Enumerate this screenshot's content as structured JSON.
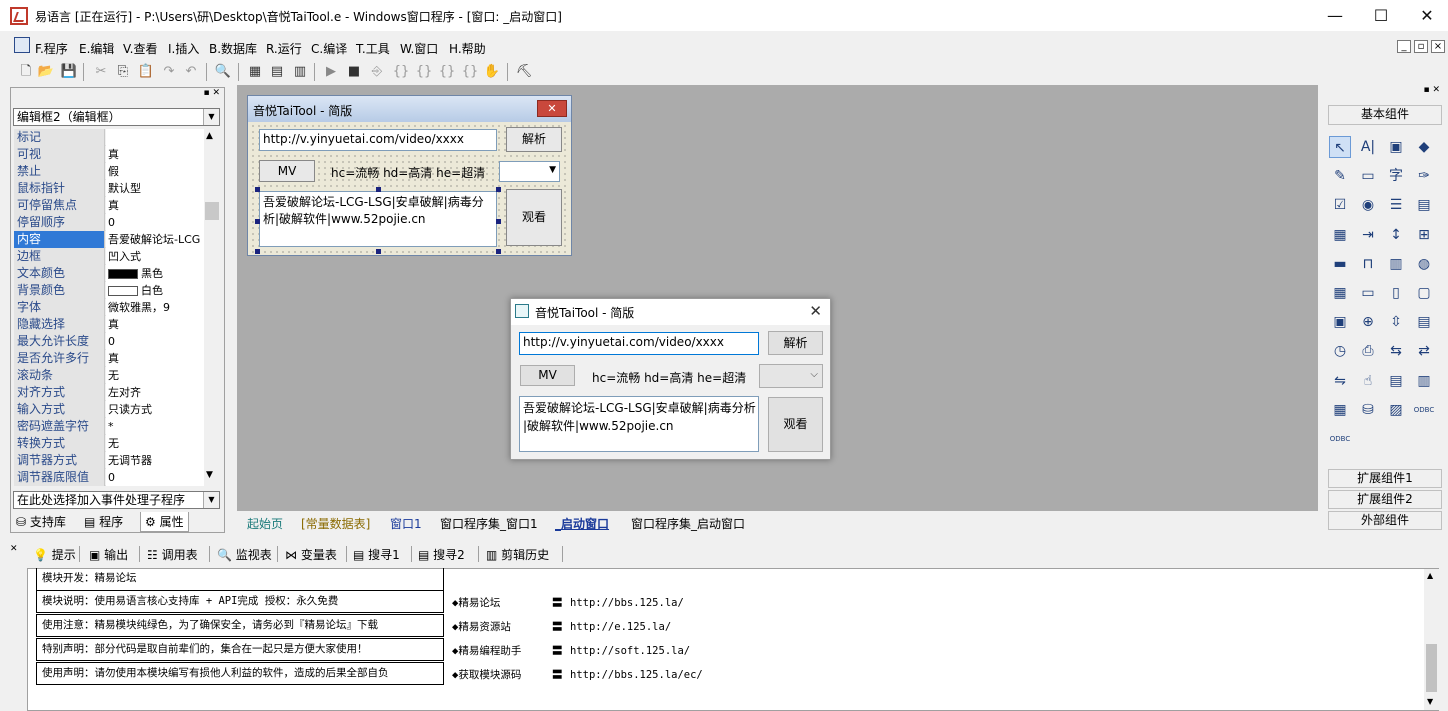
{
  "window": {
    "title": "易语言 [正在运行] - P:\\Users\\研\\Desktop\\音悦TaiTool.e - Windows窗口程序 - [窗口: _启动窗口]",
    "minimize": "—",
    "maximize": "☐",
    "close": "✕"
  },
  "menu": [
    "F.程序",
    "E.编辑",
    "V.查看",
    "I.插入",
    "B.数据库",
    "R.运行",
    "C.编译",
    "T.工具",
    "W.窗口",
    "H.帮助"
  ],
  "left_panel": {
    "component_select": "编辑框2（编辑框）",
    "properties": [
      {
        "name": "标记",
        "value": ""
      },
      {
        "name": "可视",
        "value": "真"
      },
      {
        "name": "禁止",
        "value": "假"
      },
      {
        "name": "鼠标指针",
        "value": "默认型"
      },
      {
        "name": "可停留焦点",
        "value": "真"
      },
      {
        "name": "  停留顺序",
        "value": "0"
      },
      {
        "name": "内容",
        "value": "吾爱破解论坛-LCG"
      },
      {
        "name": "边框",
        "value": "凹入式"
      },
      {
        "name": "文本颜色",
        "value": "黑色"
      },
      {
        "name": "背景颜色",
        "value": "白色"
      },
      {
        "name": "字体",
        "value": "微软雅黑，9"
      },
      {
        "name": "隐藏选择",
        "value": "真"
      },
      {
        "name": "最大允许长度",
        "value": "0"
      },
      {
        "name": "是否允许多行",
        "value": "真"
      },
      {
        "name": "滚动条",
        "value": "无"
      },
      {
        "name": "对齐方式",
        "value": "左对齐"
      },
      {
        "name": "输入方式",
        "value": "只读方式"
      },
      {
        "name": "  密码遮盖字符",
        "value": "*"
      },
      {
        "name": "转换方式",
        "value": "无"
      },
      {
        "name": "调节器方式",
        "value": "无调节器"
      },
      {
        "name": "  调节器底限值",
        "value": "0"
      }
    ],
    "event_select": "在此处选择加入事件处理子程序",
    "tabs": [
      "支持库",
      "程序",
      "属性"
    ]
  },
  "design_form": {
    "title": "音悦TaiTool - 简版",
    "url_value": "http://v.yinyuetai.com/video/xxxx",
    "parse_button": "解析",
    "mv_button": "MV",
    "quality_label": "hc=流畅 hd=高清 he=超清",
    "info_text": "吾爱破解论坛-LCG-LSG|安卓破解|病毒分析|破解软件|www.52pojie.cn",
    "watch_button": "观看"
  },
  "runtime_window": {
    "title": "音悦TaiTool - 简版",
    "url_value": "http://v.yinyuetai.com/video/xxxx",
    "parse_button": "解析",
    "mv_button": "MV",
    "quality_label": "hc=流畅 hd=高清 he=超清",
    "info_line1": "吾爱破解论坛-LCG-LSG|安卓破解|病毒分析",
    "info_line2": "|破解软件|www.52pojie.cn",
    "watch_button": "观看"
  },
  "doc_tabs": [
    "起始页",
    "[常量数据表]",
    "窗口1",
    "窗口程序集_窗口1",
    "_启动窗口",
    "窗口程序集_启动窗口"
  ],
  "right_panel": {
    "basic_components": "基本组件",
    "ext1": "扩展组件1",
    "ext2": "扩展组件2",
    "external": "外部组件"
  },
  "output_tabs": [
    "提示",
    "输出",
    "调用表",
    "监视表",
    "变量表",
    "搜寻1",
    "搜寻2",
    "剪辑历史"
  ],
  "output": {
    "boxes": [
      "模块开发：精易论坛",
      "模块说明：使用易语言核心支持库 + API完成      授权：永久免费",
      "使用注意：精易模块纯绿色，为了确保安全，请务必到『精易论坛』下载",
      "特别声明：部分代码是取自前辈们的，集合在一起只是方便大家使用！",
      "使用声明：请勿使用本模块编写有损他人利益的软件，造成的后果全部自负"
    ],
    "links": [
      {
        "name": "◆精易论坛",
        "url": "http://bbs.125.la/"
      },
      {
        "name": "◆精易资源站",
        "url": "http://e.125.la/"
      },
      {
        "name": "◆精易编程助手",
        "url": "http://soft.125.la/"
      },
      {
        "name": "◆获取模块源码",
        "url": "http://bbs.125.la/ec/"
      }
    ]
  },
  "colors": {
    "design_bg": "#ababab",
    "selected_row": "#3079d6"
  }
}
